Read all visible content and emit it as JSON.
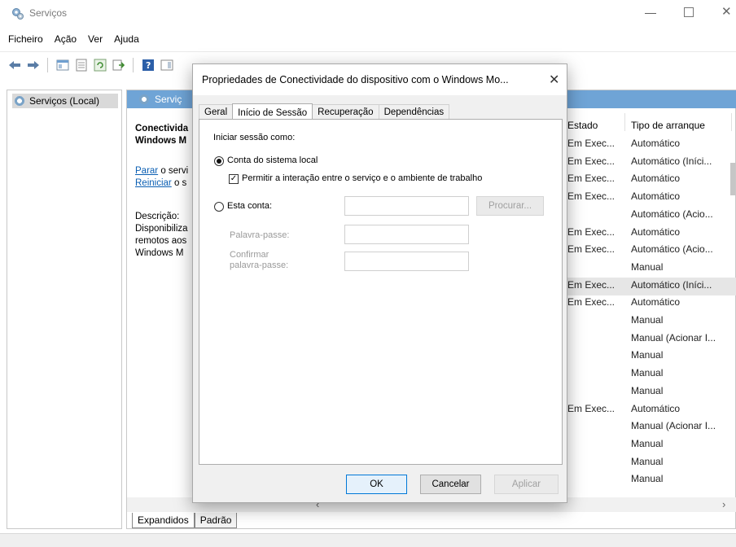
{
  "window": {
    "title": "Serviços",
    "minimize": "—",
    "close": "✕"
  },
  "menu": [
    "Ficheiro",
    "Ação",
    "Ver",
    "Ajuda"
  ],
  "tree": {
    "item_label": "Serviços (Local)"
  },
  "right_header": {
    "title": "Serviç"
  },
  "details": {
    "name_line1": "Conectivida",
    "name_line2": "Windows M",
    "stop_link": "Parar",
    "stop_tail": " o servi",
    "restart_link": "Reiniciar",
    "restart_tail": " o s",
    "desc_label": "Descrição:",
    "desc_lines": [
      "Disponibiliza",
      "remotos aos",
      "Windows M"
    ]
  },
  "columns": {
    "status": "Estado",
    "startup": "Tipo de arranque"
  },
  "rows": [
    {
      "status": "Em Exec...",
      "startup": "Automático"
    },
    {
      "status": "Em Exec...",
      "startup": "Automático (Iníci..."
    },
    {
      "status": "Em Exec...",
      "startup": "Automático"
    },
    {
      "status": "Em Exec...",
      "startup": "Automático"
    },
    {
      "status": "",
      "startup": "Automático (Acio..."
    },
    {
      "status": "Em Exec...",
      "startup": "Automático"
    },
    {
      "status": "Em Exec...",
      "startup": "Automático (Acio..."
    },
    {
      "status": "",
      "startup": "Manual"
    },
    {
      "status": "Em Exec...",
      "startup": "Automático (Iníci..."
    },
    {
      "status": "Em Exec...",
      "startup": "Automático"
    },
    {
      "status": "",
      "startup": "Manual"
    },
    {
      "status": "",
      "startup": "Manual (Acionar I..."
    },
    {
      "status": "",
      "startup": "Manual"
    },
    {
      "status": "",
      "startup": "Manual"
    },
    {
      "status": "",
      "startup": "Manual"
    },
    {
      "status": "Em Exec...",
      "startup": "Automático"
    },
    {
      "status": "",
      "startup": "Manual (Acionar I..."
    },
    {
      "status": "",
      "startup": "Manual"
    },
    {
      "status": "",
      "startup": "Manual"
    },
    {
      "status": "",
      "startup": "Manual"
    }
  ],
  "view_tabs": {
    "extended": "Expandidos",
    "standard": "Padrão"
  },
  "dialog": {
    "title": "Propriedades de Conectividade do dispositivo com o Windows Mo...",
    "close": "✕",
    "tabs": [
      "Geral",
      "Início de Sessão",
      "Recuperação",
      "Dependências"
    ],
    "active_tab": "Início de Sessão",
    "logon_as_label": "Iniciar sessão como:",
    "local_system_label": "Conta do sistema local",
    "interact_label": "Permitir a interação entre o serviço e o ambiente de trabalho",
    "this_account_label": "Esta conta:",
    "browse_button": "Procurar...",
    "password_label": "Palavra-passe:",
    "confirm_label_1": "Confirmar",
    "confirm_label_2": "palavra-passe:",
    "ok_button": "OK",
    "cancel_button": "Cancelar",
    "apply_button": "Aplicar",
    "account_value": "",
    "password_value": "",
    "confirm_value": ""
  }
}
